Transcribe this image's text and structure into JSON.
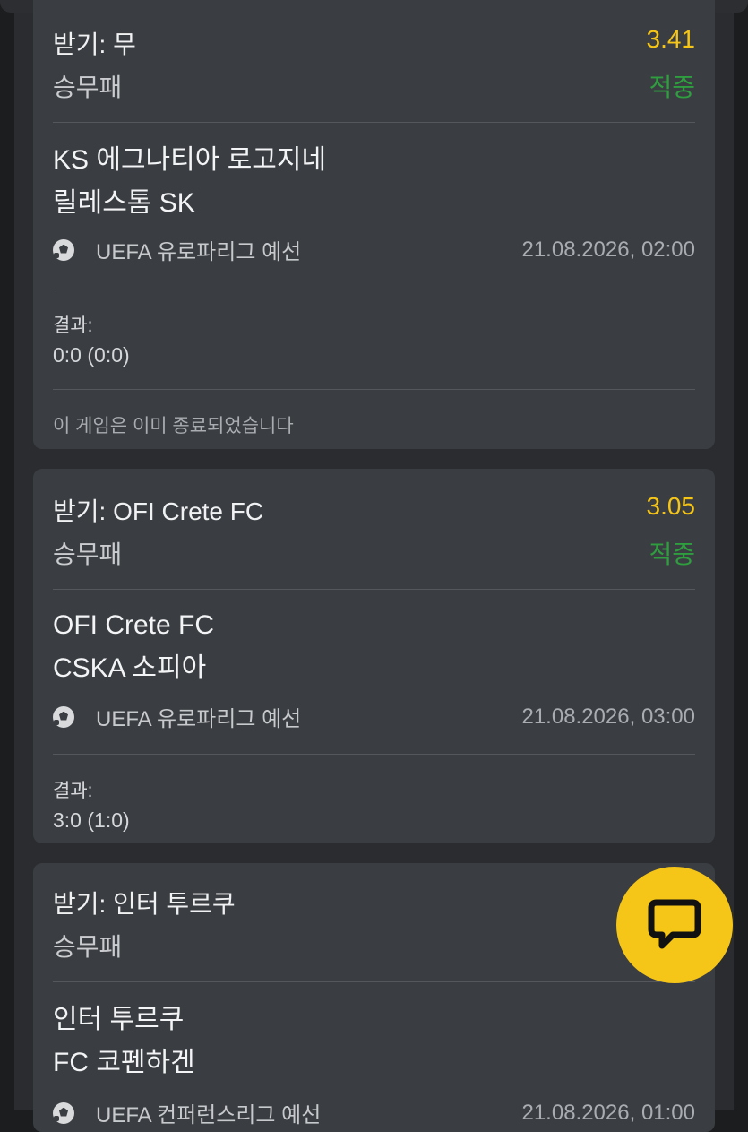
{
  "cards": [
    {
      "pick": "받기: 무",
      "odds": "3.41",
      "market": "승무패",
      "status": "적중",
      "home": "KS 에그나티아 로고지네",
      "away": "릴레스톰 SK",
      "league": "UEFA 유로파리그 예선",
      "date": "21.08.2026, 02:00",
      "result_label": "결과:",
      "result": "0:0 (0:0)",
      "note": "이 게임은 이미 종료되었습니다"
    },
    {
      "pick": "받기: OFI Crete FC",
      "odds": "3.05",
      "market": "승무패",
      "status": "적중",
      "home": "OFI Crete FC",
      "away": "CSKA 소피아",
      "league": "UEFA 유로파리그 예선",
      "date": "21.08.2026, 03:00",
      "result_label": "결과:",
      "result": "3:0 (1:0)"
    },
    {
      "pick": "받기: 인터 투르쿠",
      "market": "승무패",
      "home": "인터 투르쿠",
      "away": "FC 코펜하겐",
      "league": "UEFA 컨퍼런스리그 예선",
      "date": "21.08.2026, 01:00"
    }
  ],
  "chat_button": {
    "icon": "chat-bubble-icon"
  },
  "colors": {
    "accent": "#f5c518",
    "win": "#2e9e3e",
    "card": "#3a3d41"
  }
}
